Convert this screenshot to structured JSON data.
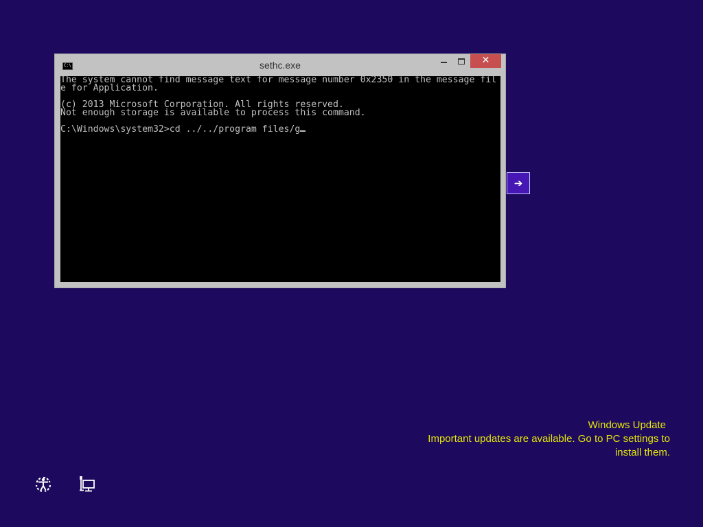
{
  "window": {
    "title": "sethc.exe",
    "icon_label": "C:\\",
    "close_glyph": "✕"
  },
  "console": {
    "lines": [
      "The system cannot find message text for message number 0x2350 in the message fil",
      "e for Application.",
      "",
      "(c) 2013 Microsoft Corporation. All rights reserved.",
      "Not enough storage is available to process this command.",
      "",
      "C:\\Windows\\system32>cd ../../program files/g"
    ]
  },
  "next_button": {
    "glyph": "➔"
  },
  "notification": {
    "title": "Windows Update",
    "body_line1": "Important updates are available. Go to PC settings to",
    "body_line2": "install them."
  },
  "icons": {
    "ease_of_access": "ease-of-access-icon",
    "network": "network-icon"
  },
  "colors": {
    "background": "#1d0a5e",
    "notification_text": "#e6e60a",
    "close_button": "#c74f4f",
    "next_button": "#4617b4"
  }
}
